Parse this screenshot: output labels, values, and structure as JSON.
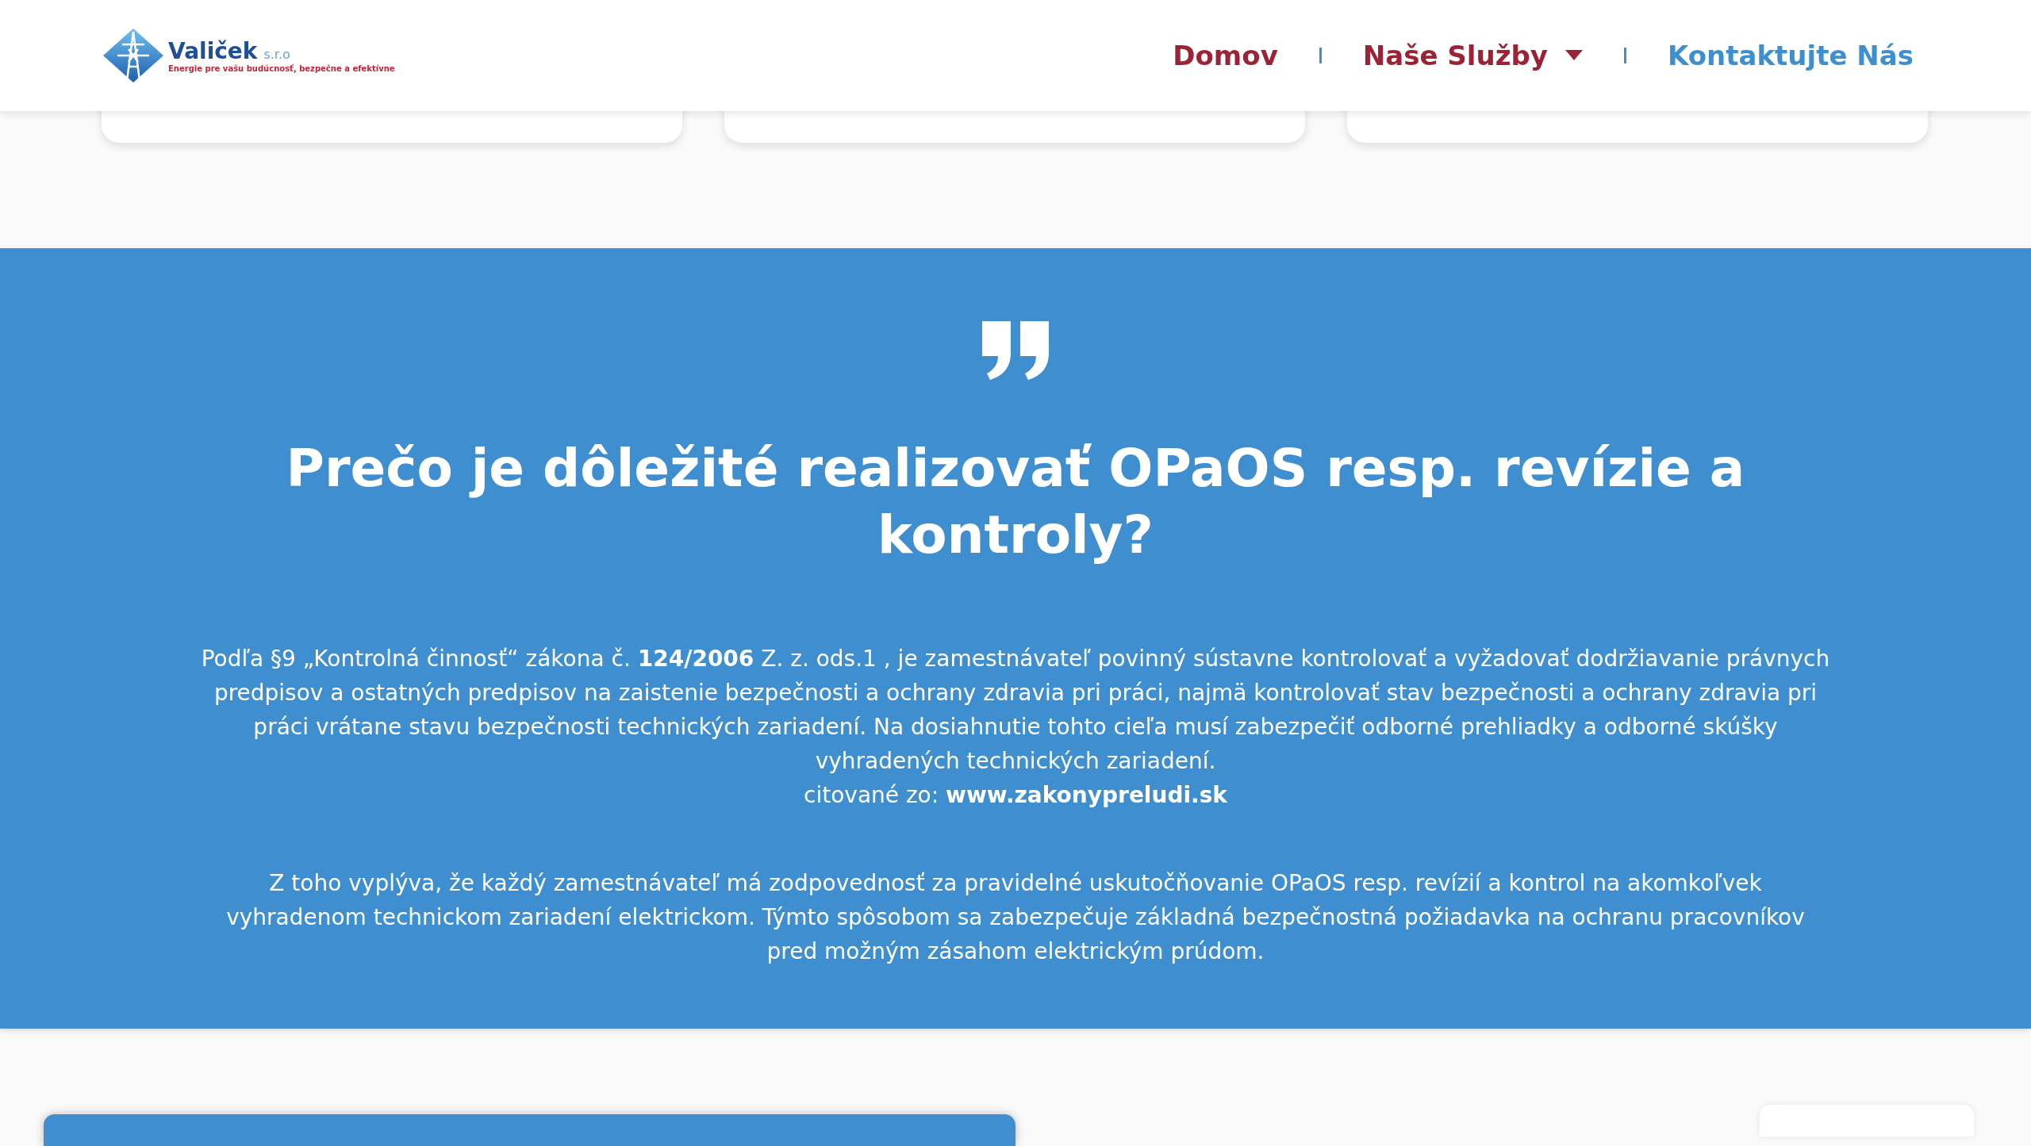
{
  "header": {
    "logo": {
      "name": "Valiček",
      "suffix": "s.r.o",
      "tagline": "Energie pre vašu budúcnosť, bezpečne a efektívne"
    },
    "nav": [
      {
        "label": "Domov",
        "kind": "link",
        "active": true
      },
      {
        "label": "Naše Služby",
        "kind": "dropdown",
        "active": true
      },
      {
        "label": "Kontaktujte Nás",
        "kind": "link",
        "active": false
      }
    ]
  },
  "cards": [
    {
      "kind": "card"
    },
    {
      "kind": "card"
    },
    {
      "kind": "card"
    }
  ],
  "quote_section": {
    "heading": "Prečo je dôležité realizovať OPaOS resp. revízie a kontroly?",
    "paragraph": "Podľa §9 „Kontrolná činnosť“ zákona č. **124/2006** Z. z. ods.1 , je zamestnávateľ povinný sústavne kontrolovať a vyžadovať dodržiavanie právnych predpisov a ostatných predpisov na zaistenie bezpečnosti a ochrany zdravia pri práci, najmä kontrolovať stav bezpečnosti a ochrany zdravia pri práci vrátane stavu bezpečnosti technických zariadení. Na dosiahnutie tohto cieľa musí zabezpečiť odborné prehliadky a odborné skúšky vyhradených technických zariadení.",
    "citation": {
      "label": "citované zo:",
      "link": "www.zakonypreludi.sk"
    },
    "conclusion": "Z toho vyplýva, že každý zamestnávateľ má zodpovednosť za pravidelné uskutočňovanie OPaOS resp. revízií a kontrol na akomkoľvek vyhradenom technickom zariadení elektrickom. Týmto spôsobom sa zabezpečuje základná bezpečnostná požiadavka na ochranu pracovníkov pred možným zásahom elektrickým prúdom."
  },
  "bottom_cards": [
    {
      "kind": "blue"
    },
    {
      "kind": "white"
    }
  ]
}
